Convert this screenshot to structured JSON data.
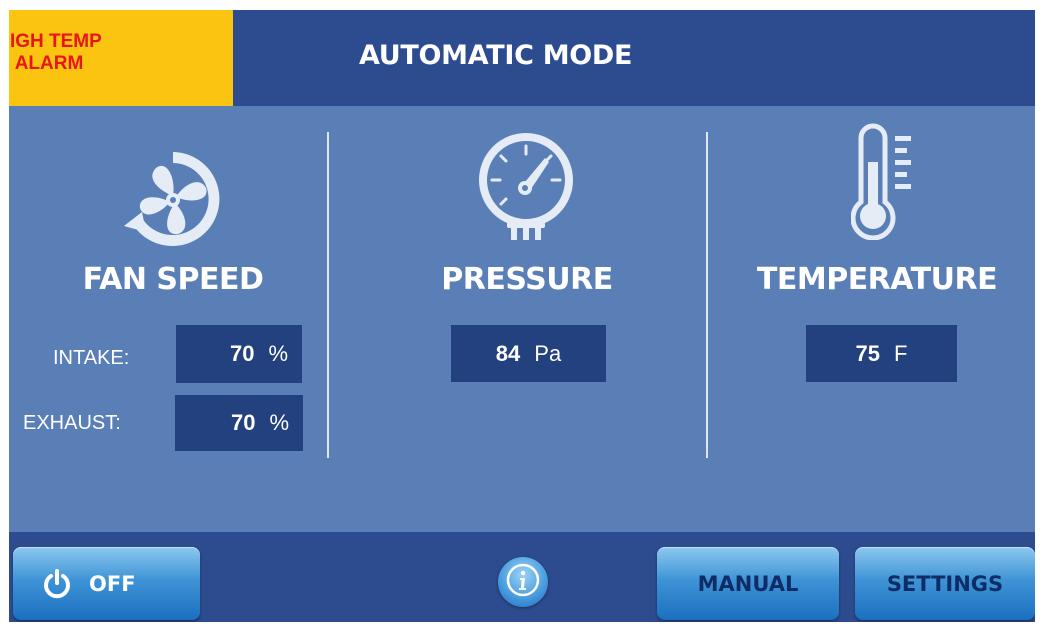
{
  "header": {
    "alarm_line1": "HIGH TEMP",
    "alarm_line2": "ALARM",
    "mode_title": "AUTOMATIC MODE"
  },
  "fan": {
    "title": "FAN SPEED",
    "icon": "fan-icon",
    "intake_label": "INTAKE:",
    "intake_value": "70",
    "intake_unit": "%",
    "exhaust_label": "EXHAUST:",
    "exhaust_value": "70",
    "exhaust_unit": "%"
  },
  "pressure": {
    "title": "PRESSURE",
    "icon": "pressure-gauge-icon",
    "value": "84",
    "unit": "Pa"
  },
  "temperature": {
    "title": "TEMPERATURE",
    "icon": "thermometer-icon",
    "value": "75",
    "unit": "F"
  },
  "footer": {
    "off_label": "OFF",
    "info_icon": "info-icon",
    "manual_label": "MANUAL",
    "settings_label": "SETTINGS"
  },
  "colors": {
    "background": "#5a7fb7",
    "header": "#2d4c8f",
    "alarm_bg": "#fbc410",
    "alarm_text": "#e8151b",
    "value_box": "#23407f",
    "button": "#3f94d6"
  }
}
